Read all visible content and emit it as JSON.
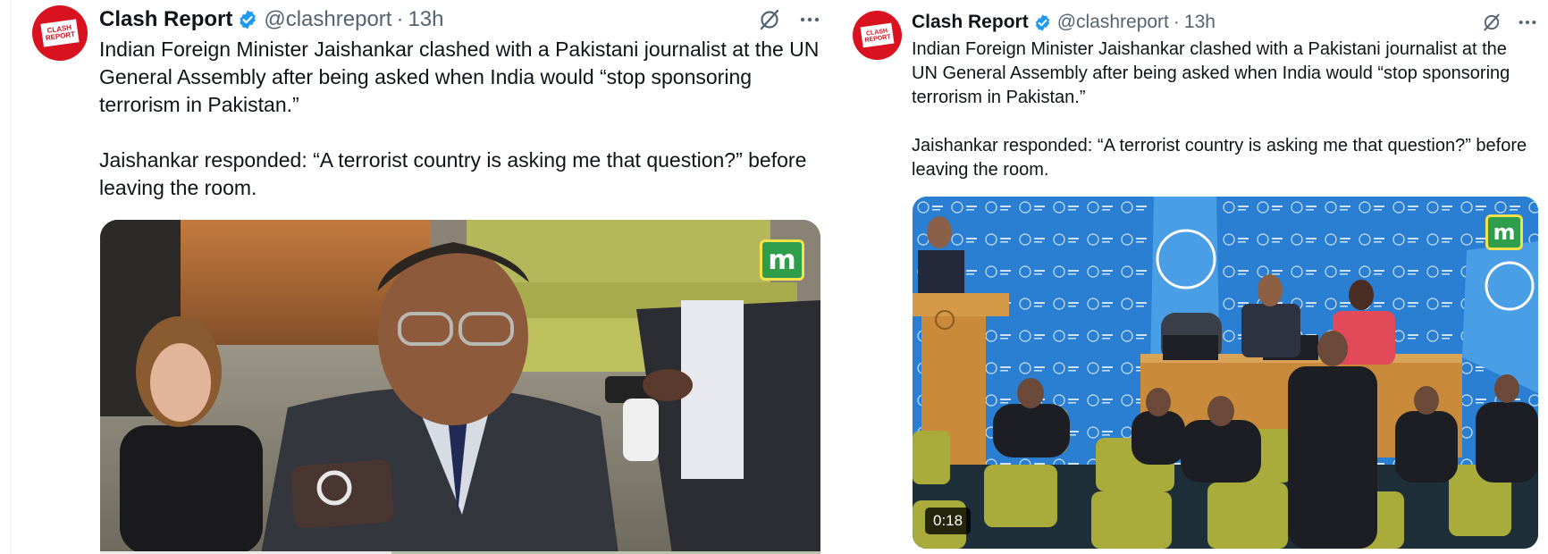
{
  "tweets": [
    {
      "author": {
        "name": "Clash Report",
        "handle": "@clashreport",
        "avatar_text": [
          "CLASH",
          "REPORT"
        ]
      },
      "separator": "·",
      "time": "13h",
      "text": [
        "Indian Foreign Minister Jaishankar clashed with a Pakistani journalist at the UN General Assembly after being asked when India would “stop sponsoring terrorism in Pakistan.”",
        "Jaishankar responded: “A terrorist country is asking me that question?” before leaving the room."
      ],
      "media": {
        "type": "video",
        "watermark": "m"
      }
    },
    {
      "author": {
        "name": "Clash Report",
        "handle": "@clashreport",
        "avatar_text": [
          "CLASH",
          "REPORT"
        ]
      },
      "separator": "·",
      "time": "13h",
      "text": [
        "Indian Foreign Minister Jaishankar clashed with a Pakistani journalist at the UN General Assembly after being asked when India would “stop sponsoring terrorism in Pakistan.”",
        "Jaishankar responded: “A terrorist country is asking me that question?” before leaving the room."
      ],
      "media": {
        "type": "video",
        "watermark": "m",
        "duration": "0:18"
      }
    }
  ],
  "icons": {
    "verified": "verified-badge-icon",
    "grok": "grok-icon",
    "more": "more-icon"
  },
  "colors": {
    "verified": "#1d9bf0",
    "text": "#0f1419",
    "secondary": "#536471",
    "brand_red": "#d9121f",
    "watermark_green": "#2e9e4a",
    "un_blue": "#2a7fd2"
  }
}
